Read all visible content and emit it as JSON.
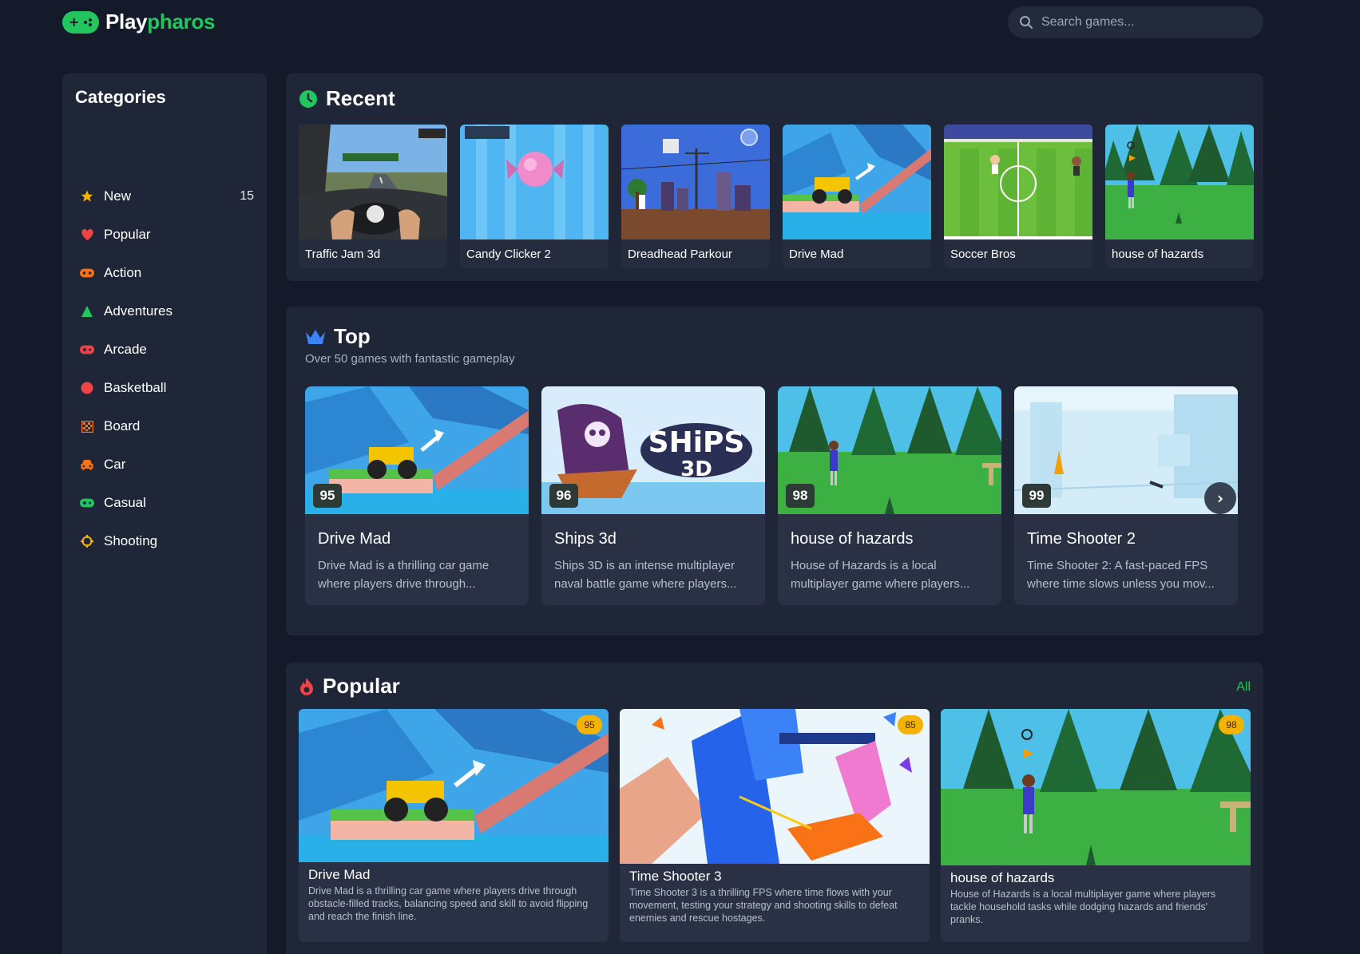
{
  "brand": {
    "name_part1": "Play",
    "name_part2": "pharos",
    "accent": "#22c55e"
  },
  "search": {
    "placeholder": "Search games..."
  },
  "sidebar": {
    "title": "Categories",
    "items": [
      {
        "label": "New",
        "count": "15",
        "icon": "star-icon",
        "color": "#f5b301"
      },
      {
        "label": "Popular",
        "count": "",
        "icon": "heart-icon",
        "color": "#ef4444"
      },
      {
        "label": "Action",
        "count": "",
        "icon": "gamepad-icon",
        "color": "#f97316"
      },
      {
        "label": "Adventures",
        "count": "",
        "icon": "triangle-icon",
        "color": "#22c55e"
      },
      {
        "label": "Arcade",
        "count": "",
        "icon": "joystick-icon",
        "color": "#ef4444"
      },
      {
        "label": "Basketball",
        "count": "",
        "icon": "ball-icon",
        "color": "#ef4444"
      },
      {
        "label": "Board",
        "count": "",
        "icon": "grid-icon",
        "color": "#f97316"
      },
      {
        "label": "Car",
        "count": "",
        "icon": "car-icon",
        "color": "#f97316"
      },
      {
        "label": "Casual",
        "count": "",
        "icon": "controller-icon",
        "color": "#22c55e"
      },
      {
        "label": "Shooting",
        "count": "",
        "icon": "crosshair-icon",
        "color": "#f5b301"
      }
    ]
  },
  "recent": {
    "title": "Recent",
    "games": [
      {
        "title": "Traffic Jam 3d"
      },
      {
        "title": "Candy Clicker 2"
      },
      {
        "title": "Dreadhead Parkour"
      },
      {
        "title": "Drive Mad"
      },
      {
        "title": "Soccer Bros"
      },
      {
        "title": "house of hazards"
      }
    ]
  },
  "top": {
    "title": "Top",
    "subtitle": "Over 50 games with fantastic gameplay",
    "games": [
      {
        "rating": "95",
        "title": "Drive Mad",
        "desc": "Drive Mad is a thrilling car game where players drive through..."
      },
      {
        "rating": "96",
        "title": "Ships 3d",
        "desc": "Ships 3D is an intense multiplayer naval battle game where players..."
      },
      {
        "rating": "98",
        "title": "house of hazards",
        "desc": "House of Hazards is a local multiplayer game where players..."
      },
      {
        "rating": "99",
        "title": "Time Shooter 2",
        "desc": "Time Shooter 2: A fast-paced FPS where time slows unless you mov..."
      }
    ],
    "next_label": "›",
    "ships_logo_line1": "SHiPS",
    "ships_logo_line2": "3D"
  },
  "popular": {
    "title": "Popular",
    "all_label": "All",
    "games": [
      {
        "rating": "95",
        "title": "Drive Mad",
        "desc": "Drive Mad is a thrilling car game where players drive through obstacle-filled tracks, balancing speed and skill to avoid flipping and reach the finish line."
      },
      {
        "rating": "85",
        "title": "Time Shooter 3",
        "desc": "Time Shooter 3 is a thrilling FPS where time flows with your movement, testing your strategy and shooting skills to defeat enemies and rescue hostages."
      },
      {
        "rating": "98",
        "title": "house of hazards",
        "desc": "House of Hazards is a local multiplayer game where players tackle household tasks while dodging hazards and friends' pranks."
      }
    ]
  }
}
